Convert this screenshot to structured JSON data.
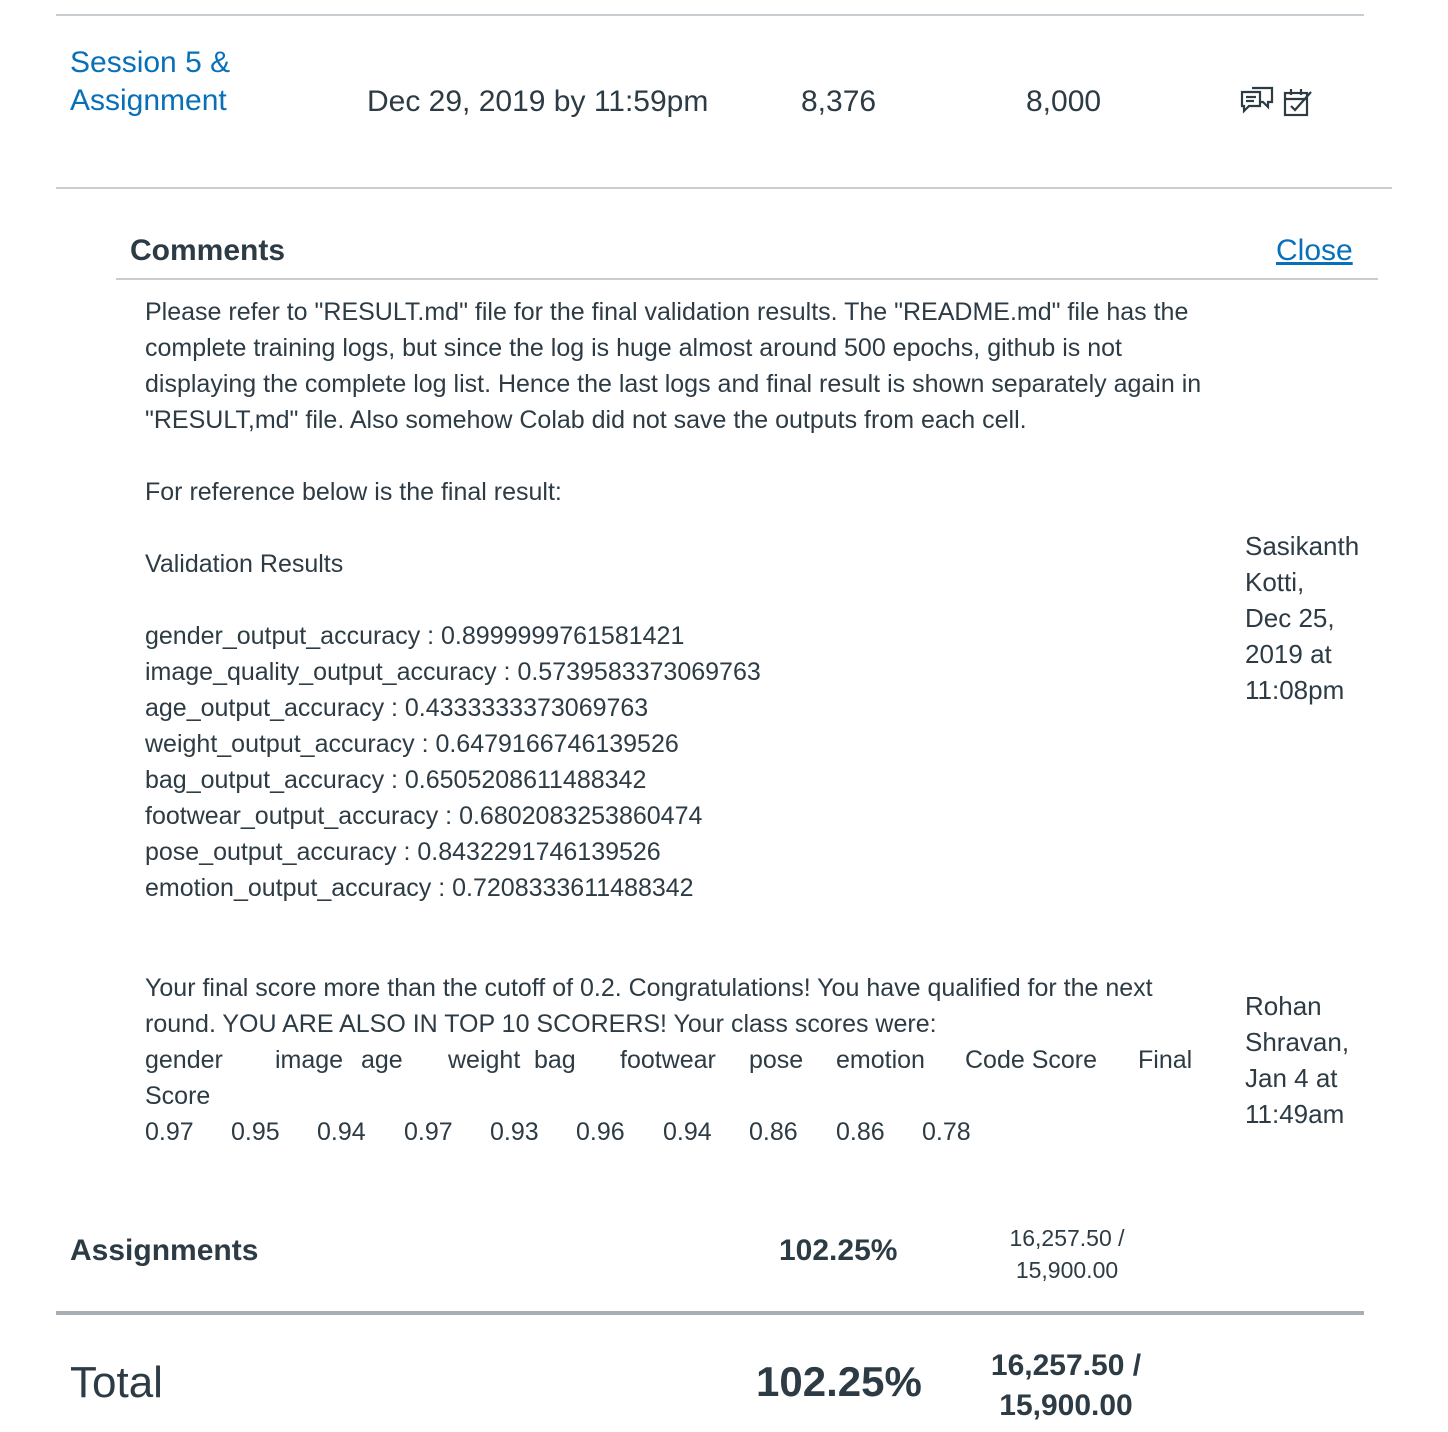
{
  "assignment_row": {
    "name": "Session 5 & Assignment",
    "due": "Dec 29, 2019 by 11:59pm",
    "score": "8,376",
    "out_of": "8,000"
  },
  "comments": {
    "title": "Comments",
    "close_label": "Close",
    "items": [
      {
        "text": "Please refer to \"RESULT.md\" file for the final validation results. The \"README.md\" file has the complete training logs, but since the log is huge almost around 500 epochs, github is not displaying the complete log list. Hence the last logs and final result is shown separately again in \"RESULT,md\" file. Also somehow Colab did not save the outputs from each cell.",
        "ref_line": "For reference below is the final result:",
        "heading": "Validation Results",
        "metrics": [
          "gender_output_accuracy : 0.8999999761581421",
          "image_quality_output_accuracy : 0.5739583373069763",
          "age_output_accuracy : 0.4333333373069763",
          "weight_output_accuracy : 0.6479166746139526",
          "bag_output_accuracy : 0.6505208611488342",
          "footwear_output_accuracy : 0.6802083253860474",
          "pose_output_accuracy : 0.8432291746139526",
          "emotion_output_accuracy : 0.7208333611488342"
        ],
        "author_lines": [
          "Sasikanth",
          "Kotti,",
          "Dec 25,",
          "2019 at",
          "11:08pm"
        ]
      },
      {
        "text": "Your final score more than the cutoff of 0.2. Congratulations! You have qualified for the next round. YOU ARE ALSO IN TOP 10 SCORERS! Your class scores were:",
        "score_headers": [
          "gender",
          "image",
          "age",
          "weight",
          "bag",
          "footwear",
          "pose",
          "emotion",
          "Code Score",
          "Final"
        ],
        "score_header_wrap": "Score",
        "score_values": [
          "0.97",
          "0.95",
          "0.94",
          "0.97",
          "0.93",
          "0.96",
          "0.94",
          "0.86",
          "0.86",
          "0.78"
        ],
        "author_lines": [
          "Rohan",
          "Shravan,",
          "Jan 4 at",
          "11:49am"
        ]
      }
    ]
  },
  "summary": {
    "assignments_label": "Assignments",
    "assignments_pct": "102.25%",
    "assignments_pts_line1": "16,257.50 /",
    "assignments_pts_line2": "15,900.00",
    "total_label": "Total",
    "total_pct": "102.25%",
    "total_pts_line1": "16,257.50 /",
    "total_pts_line2": "15,900.00"
  },
  "icons": [
    "comments-icon",
    "rubric-icon"
  ],
  "colors": {
    "link": "#0770b8",
    "text": "#2d3b45",
    "divider": "#c7cdd1"
  }
}
